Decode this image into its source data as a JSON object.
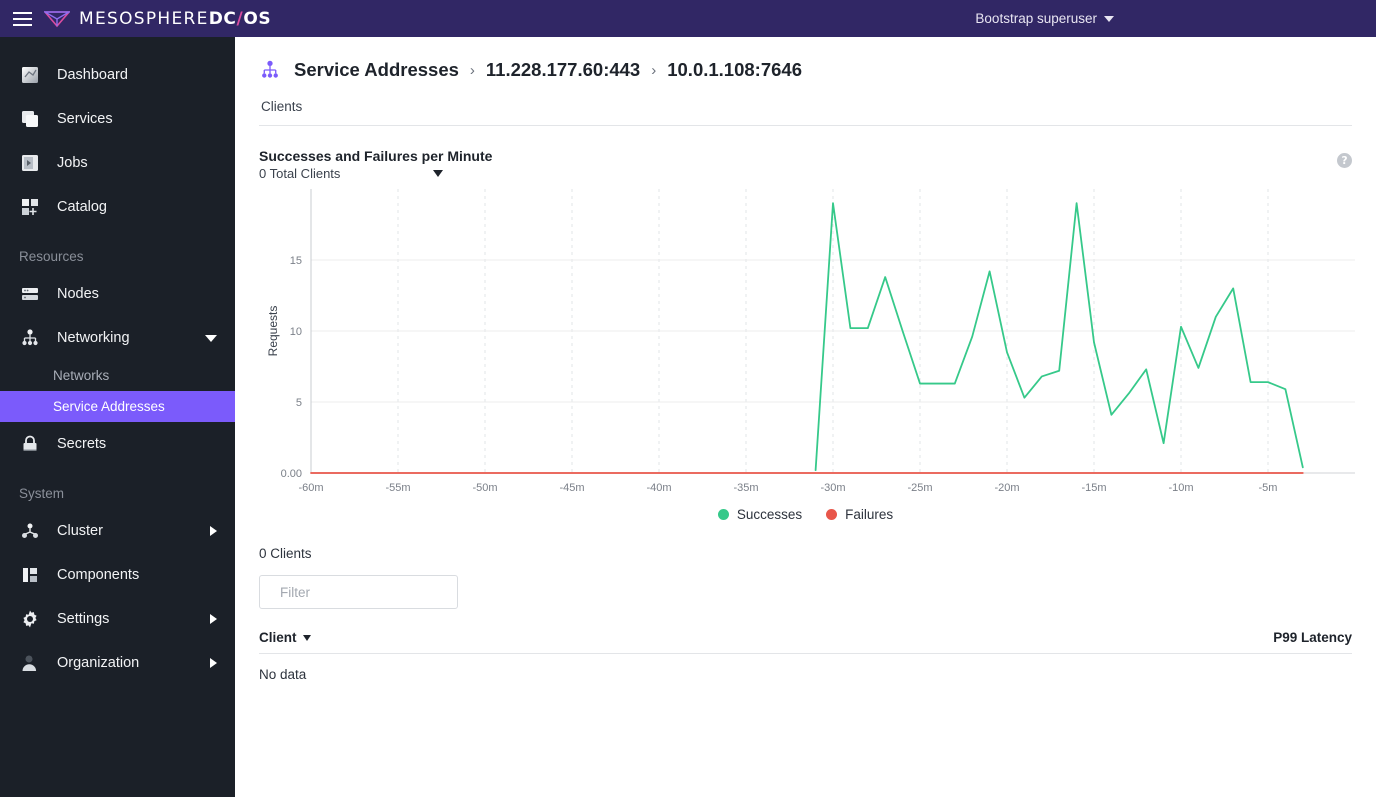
{
  "topbar": {
    "menu_icon": "hamburger-icon",
    "brand_mesosphere": "MESOSPHERE",
    "brand_dc": "DC",
    "brand_slash": "/",
    "brand_os": "OS",
    "user_label": "Bootstrap superuser",
    "bg_color": "#312765",
    "accent_pink": "#d94ca0"
  },
  "sidebar": {
    "bg_color": "#1b2028",
    "active_color": "#7b5bfb",
    "items": [
      {
        "label": "Dashboard",
        "icon": "dashboard-icon"
      },
      {
        "label": "Services",
        "icon": "services-icon"
      },
      {
        "label": "Jobs",
        "icon": "jobs-icon"
      },
      {
        "label": "Catalog",
        "icon": "catalog-icon"
      }
    ],
    "resources_section": "Resources",
    "resources_items": [
      {
        "label": "Nodes",
        "icon": "nodes-icon"
      },
      {
        "label": "Networking",
        "icon": "networking-icon"
      }
    ],
    "networking_sub": [
      {
        "label": "Networks",
        "active": false
      },
      {
        "label": "Service Addresses",
        "active": true
      }
    ],
    "secrets": {
      "label": "Secrets",
      "icon": "lock-icon"
    },
    "system_section": "System",
    "system_items": [
      {
        "label": "Cluster",
        "icon": "cluster-icon",
        "expandable": true
      },
      {
        "label": "Components",
        "icon": "components-icon",
        "expandable": false
      },
      {
        "label": "Settings",
        "icon": "gear-icon",
        "expandable": true
      },
      {
        "label": "Organization",
        "icon": "user-icon",
        "expandable": true
      }
    ]
  },
  "breadcrumb": {
    "icon": "service-address-icon",
    "root": "Service Addresses",
    "sep": "›",
    "level2": "11.228.177.60:443",
    "level3": "10.0.1.108:7646"
  },
  "tabs": [
    {
      "label": "Clients",
      "active": true
    }
  ],
  "panel": {
    "help_glyph": "?",
    "dropdown_caret": "caret-down-icon"
  },
  "table": {
    "clients_count_label": "0 Clients",
    "filter_placeholder": "Filter",
    "filter_value": "",
    "search_icon": "search-icon",
    "col_client": "Client",
    "col_latency": "P99 Latency",
    "empty_text": "No data"
  },
  "chart_data": {
    "type": "line",
    "title": "Successes and Failures per Minute",
    "subtitle": "0 Total Clients",
    "xlabel": "",
    "ylabel": "Requests",
    "ylim": [
      0,
      20
    ],
    "xlim": [
      -60,
      0
    ],
    "grid": true,
    "legend_position": "bottom",
    "y_ticks": [
      "0.00",
      "5",
      "10",
      "15"
    ],
    "y_tick_values": [
      0,
      5,
      10,
      15
    ],
    "x_ticks": [
      "-60m",
      "-55m",
      "-50m",
      "-45m",
      "-40m",
      "-35m",
      "-30m",
      "-25m",
      "-20m",
      "-15m",
      "-10m",
      "-5m"
    ],
    "x_tick_values": [
      -60,
      -55,
      -50,
      -45,
      -40,
      -35,
      -30,
      -25,
      -20,
      -15,
      -10,
      -5
    ],
    "colors": {
      "successes": "#36c98a",
      "failures": "#e8564a"
    },
    "series": [
      {
        "name": "Successes",
        "color": "#36c98a",
        "x": [
          -31,
          -30,
          -29,
          -28,
          -27,
          -26,
          -25,
          -24,
          -23,
          -22,
          -21,
          -20,
          -19,
          -18,
          -17,
          -16,
          -15,
          -14,
          -13,
          -12,
          -11,
          -10,
          -9,
          -8,
          -7,
          -6,
          -5,
          -4,
          -3
        ],
        "values": [
          0.2,
          19,
          10.2,
          10.2,
          13.8,
          10.0,
          6.3,
          6.3,
          6.3,
          9.6,
          14.2,
          8.5,
          5.3,
          6.8,
          7.2,
          19,
          9.2,
          4.1,
          5.6,
          7.3,
          2.1,
          10.3,
          7.4,
          11.0,
          13.0,
          6.4,
          6.4,
          5.9,
          0.4
        ]
      },
      {
        "name": "Failures",
        "color": "#e8564a",
        "x": [
          -60,
          -55,
          -50,
          -45,
          -40,
          -35,
          -30,
          -25,
          -20,
          -15,
          -10,
          -5,
          -3
        ],
        "values": [
          0,
          0,
          0,
          0,
          0,
          0,
          0,
          0,
          0,
          0,
          0,
          0,
          0
        ]
      }
    ],
    "legend": [
      {
        "name": "Successes",
        "color": "#36c98a"
      },
      {
        "name": "Failures",
        "color": "#e8564a"
      }
    ]
  }
}
